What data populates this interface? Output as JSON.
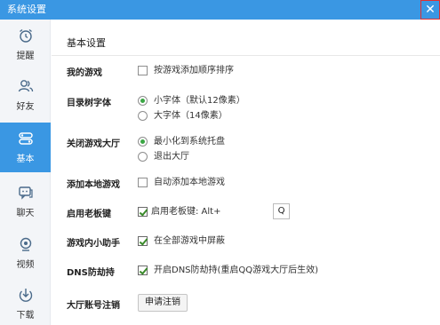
{
  "window": {
    "title": "系统设置",
    "close_glyph": "✕"
  },
  "sidebar": {
    "items": [
      {
        "label": "提醒",
        "icon": "alarm-clock-icon"
      },
      {
        "label": "好友",
        "icon": "friends-icon"
      },
      {
        "label": "基本",
        "icon": "basic-settings-icon",
        "active": true
      },
      {
        "label": "聊天",
        "icon": "chat-icon"
      },
      {
        "label": "视频",
        "icon": "video-icon"
      },
      {
        "label": "下载",
        "icon": "download-icon"
      }
    ],
    "active_color": "#3a97e3"
  },
  "main": {
    "section_title": "基本设置",
    "my_games": {
      "label": "我的游戏",
      "option": "按游戏添加顺序排序",
      "checked": false
    },
    "tree_font": {
      "label": "目录树字体",
      "options": [
        "小字体（默认12像素）",
        "大字体（14像素）"
      ],
      "selected_index": 0
    },
    "close_lobby": {
      "label": "关闭游戏大厅",
      "options": [
        "最小化到系统托盘",
        "退出大厅"
      ],
      "selected_index": 0
    },
    "add_local": {
      "label": "添加本地游戏",
      "option": "自动添加本地游戏",
      "checked": false
    },
    "boss_key": {
      "label": "启用老板键",
      "option": "启用老板键: Alt+",
      "key": "Q",
      "checked": true
    },
    "assistant": {
      "label": "游戏内小助手",
      "option": "在全部游戏中屏蔽",
      "checked": true
    },
    "dns": {
      "label": "DNS防劫持",
      "option": "开启DNS防劫持(重启QQ游戏大厅后生效)",
      "checked": true
    },
    "account": {
      "label": "大厅账号注销",
      "button": "申请注销"
    }
  }
}
